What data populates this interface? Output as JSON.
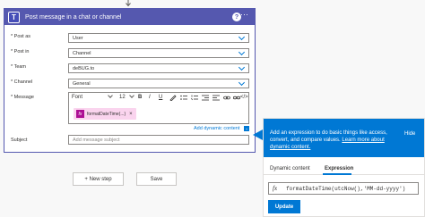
{
  "card": {
    "title": "Post message in a chat or channel",
    "help_icon": "?",
    "more_icon": "···",
    "logo_letter": "T"
  },
  "fields": {
    "post_as": {
      "label": "* Post as",
      "value": "User"
    },
    "post_in": {
      "label": "* Post in",
      "value": "Channel"
    },
    "team": {
      "label": "* Team",
      "value": "deBUG.to"
    },
    "channel": {
      "label": "* Channel",
      "value": "General"
    },
    "message": {
      "label": "* Message"
    },
    "subject": {
      "label": "Subject",
      "placeholder": "Add message subject"
    }
  },
  "editor": {
    "font_label": "Font",
    "size_label": "12",
    "bold": "B",
    "italic": "I",
    "underline": "U",
    "code": "</>",
    "token_icon": "fx",
    "token_label": "formatDateTime(...)",
    "token_remove": "×"
  },
  "add_dynamic": {
    "label": "Add dynamic content",
    "icon": "+"
  },
  "buttons": {
    "new_step": "+ New step",
    "save": "Save"
  },
  "flyout": {
    "description": "Add an expression to do basic things like access, convert, and compare values.",
    "link": "Learn more about dynamic content.",
    "hide": "Hide",
    "tabs": [
      "Dynamic content",
      "Expression"
    ],
    "fx": "fx",
    "expression": "formatDateTime(utcNow(),'MM-dd-yyyy')",
    "update": "Update"
  }
}
